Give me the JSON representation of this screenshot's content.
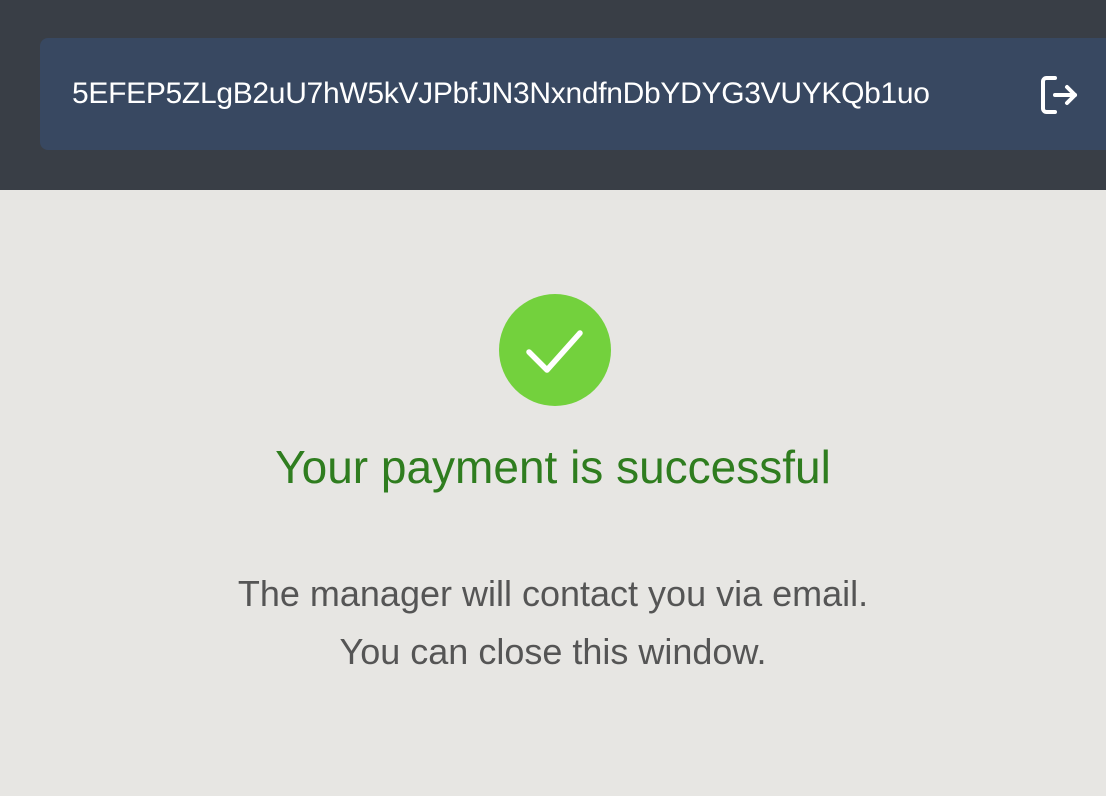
{
  "header": {
    "wallet_address": "5EFEP5ZLgB2uU7hW5kVJPbfJN3NxndfnDbYDYG3VUYKQb1uo",
    "logout_icon": "logout-icon",
    "colors": {
      "bar_background": "#393e46",
      "pill_background": "#384861",
      "text": "#ffffff"
    }
  },
  "main": {
    "status_icon": "check-icon",
    "title": "Your payment is successful",
    "message_line_1": "The manager will contact you via email.",
    "message_line_2": "You can close this window.",
    "colors": {
      "page_background": "#e7e6e3",
      "success_circle": "#73d13d",
      "title": "#2f7d1f",
      "message": "#555555"
    }
  }
}
